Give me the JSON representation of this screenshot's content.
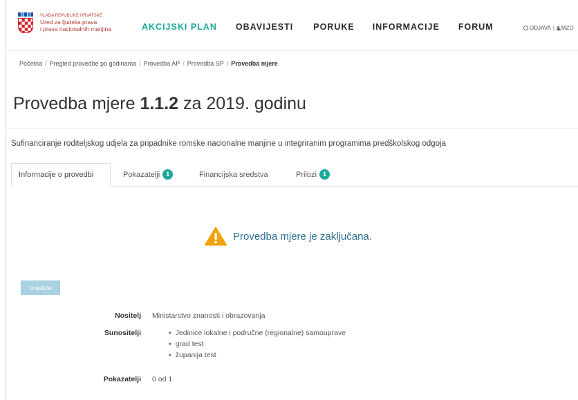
{
  "header": {
    "logo": {
      "gov_line": "VLADA REPUBLIKE HRVATSKE",
      "org_line1": "Ured za ljudska prava",
      "org_line2": "i prava nacionalnih manjina"
    },
    "nav": [
      {
        "label": "AKCIJSKI PLAN",
        "active": true
      },
      {
        "label": "OBAVIJESTI",
        "active": false
      },
      {
        "label": "PORUKE",
        "active": false
      },
      {
        "label": "INFORMACIJE",
        "active": false
      },
      {
        "label": "FORUM",
        "active": false
      }
    ],
    "logout_label": "ODJAVA",
    "separator": "|",
    "user_label": "MZO"
  },
  "breadcrumb": [
    {
      "label": "Početna"
    },
    {
      "label": "Pregled provedbe po godinama"
    },
    {
      "label": "Provedba AP"
    },
    {
      "label": "Provedba SP"
    },
    {
      "label": "Provedba mjere",
      "current": true
    }
  ],
  "page_title": {
    "prefix": "Provedba mjere",
    "measure": "1.1.2",
    "suffix": "za 2019. godinu"
  },
  "subtitle": "Sufinanciranje roditeljskog udjela za pripadnike romske nacionalne manjine u integriranim programima predškolskog odgoja",
  "tabs": [
    {
      "label": "Informacije o provedbi",
      "active": true,
      "badge": null
    },
    {
      "label": "Pokazatelji",
      "active": false,
      "badge": "1"
    },
    {
      "label": "Financijska sredstva",
      "active": false,
      "badge": null
    },
    {
      "label": "Prilozi",
      "active": false,
      "badge": "1"
    }
  ],
  "notice": "Provedba mjere je zaključana.",
  "edit_button": "Izvješće",
  "details": {
    "nositelj_label": "Nositelj",
    "nositelj_value": "Ministarstvo znanosti i obrazovanja",
    "sunositelji_label": "Sunositelji",
    "sunositelji": [
      "Jedinice lokalne i područne (regionalne) samouprave",
      "grad test",
      "županija test"
    ],
    "pokazatelji_label": "Pokazatelji",
    "pokazatelji_value": "0 od 1"
  },
  "colors": {
    "accent": "#1aa89c",
    "notice_text": "#2e6f95",
    "warning": "#f0a30a",
    "button": "#a9d2e1"
  }
}
